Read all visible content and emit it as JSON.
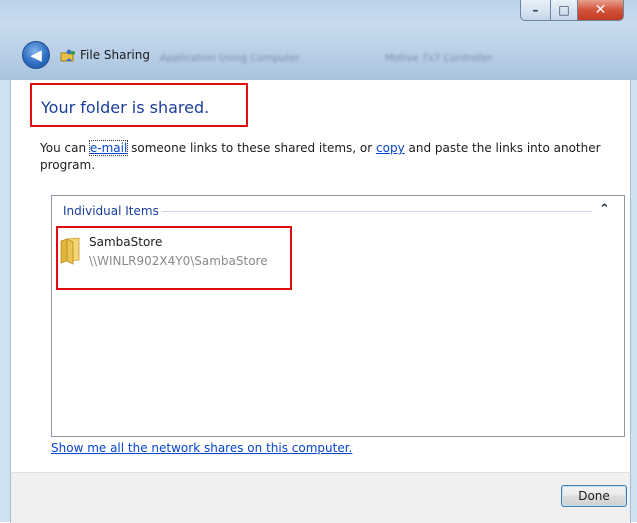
{
  "window": {
    "title": "File Sharing",
    "ghost_tab_1": "Application Using Computer",
    "ghost_tab_2": "Motive 7x7 Controller",
    "minimize_glyph": "–",
    "maximize_glyph": "□",
    "close_glyph": "✕",
    "back_glyph": "◀"
  },
  "main": {
    "heading": "Your folder is shared.",
    "desc_prefix": "You can ",
    "email_link": "e-mail",
    "desc_middle": " someone links to these shared items, or ",
    "copy_link": "copy",
    "desc_suffix": " and paste the links into another program."
  },
  "items_panel": {
    "group_header": "Individual Items",
    "collapse_glyph": "⌃",
    "items": [
      {
        "name": "SambaStore",
        "path": "\\\\WINLR902X4Y0\\SambaStore",
        "icon": "folder-icon"
      }
    ]
  },
  "network_link": "Show me all the network shares on this computer.",
  "footer": {
    "done_label": "Done"
  },
  "colors": {
    "highlight_box": "#e20e0e",
    "link": "#0645ce",
    "heading": "#1a3f9a"
  }
}
